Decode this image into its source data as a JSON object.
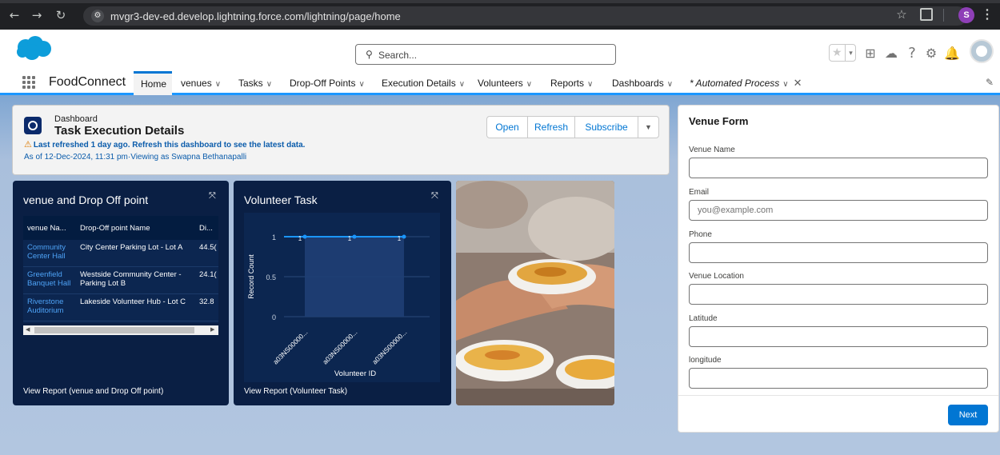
{
  "browser": {
    "url": "mvgr3-dev-ed.develop.lightning.force.com/lightning/page/home",
    "profile_initial": "S"
  },
  "header": {
    "search_placeholder": "Search..."
  },
  "nav": {
    "app_name": "FoodConnect",
    "items": [
      {
        "label": "Home",
        "active": true
      },
      {
        "label": "venues",
        "dropdown": true
      },
      {
        "label": "Tasks",
        "dropdown": true
      },
      {
        "label": "Drop-Off Points",
        "dropdown": true
      },
      {
        "label": "Execution Details",
        "dropdown": true
      },
      {
        "label": "Volunteers",
        "dropdown": true
      },
      {
        "label": "Reports",
        "dropdown": true
      },
      {
        "label": "Dashboards",
        "dropdown": true
      },
      {
        "label": "* Automated Process",
        "dropdown": true,
        "closable": true
      }
    ]
  },
  "dashboard": {
    "label": "Dashboard",
    "title": "Task Execution Details",
    "warning": "Last refreshed 1 day ago. Refresh this dashboard to see the latest data.",
    "as_of": "As of 12-Dec-2024, 11:31 pm·Viewing as Swapna Bethanapalli",
    "buttons": {
      "open": "Open",
      "refresh": "Refresh",
      "subscribe": "Subscribe"
    }
  },
  "widget_table": {
    "title": "venue and Drop Off point",
    "columns": [
      "venue Na...",
      "Drop-Off point Name",
      "Di..."
    ],
    "rows": [
      {
        "venue": "Community Center Hall",
        "dropoff": "City Center Parking Lot - Lot A",
        "dist": "44.5("
      },
      {
        "venue": "Greenfield Banquet Hall",
        "dropoff": "Westside Community Center - Parking Lot B",
        "dist": "24.1("
      },
      {
        "venue": "Riverstone Auditorium",
        "dropoff": "Lakeside Volunteer Hub - Lot C",
        "dist": "32.8"
      }
    ],
    "footer": "View Report (venue and Drop Off point)"
  },
  "widget_chart": {
    "title": "Volunteer Task",
    "footer": "View Report (Volunteer Task)"
  },
  "chart_data": {
    "type": "line",
    "categories": [
      "a03NS00000...",
      "a03NS00000...",
      "a03NS00000..."
    ],
    "values": [
      1,
      1,
      1
    ],
    "data_labels": [
      "1",
      "1",
      "1"
    ],
    "xlabel": "Volunteer ID",
    "ylabel": "Record Count",
    "ylim": [
      0,
      1
    ],
    "yticks": [
      "1",
      "0.5",
      "0"
    ],
    "color": "#1b96ff"
  },
  "form": {
    "title": "Venue Form",
    "fields": [
      {
        "label": "Venue Name",
        "value": "",
        "placeholder": ""
      },
      {
        "label": "Email",
        "value": "",
        "placeholder": "you@example.com"
      },
      {
        "label": "Phone",
        "value": "",
        "placeholder": ""
      },
      {
        "label": "Venue Location",
        "value": "",
        "placeholder": ""
      },
      {
        "label": "Latitude",
        "value": "",
        "placeholder": ""
      },
      {
        "label": "longitude",
        "value": "",
        "placeholder": ""
      }
    ],
    "next_label": "Next"
  },
  "colors": {
    "brand": "#0176d3",
    "widget_bg": "#0a1f44",
    "link": "#4ea3f7",
    "warning": "#dd7a01"
  }
}
